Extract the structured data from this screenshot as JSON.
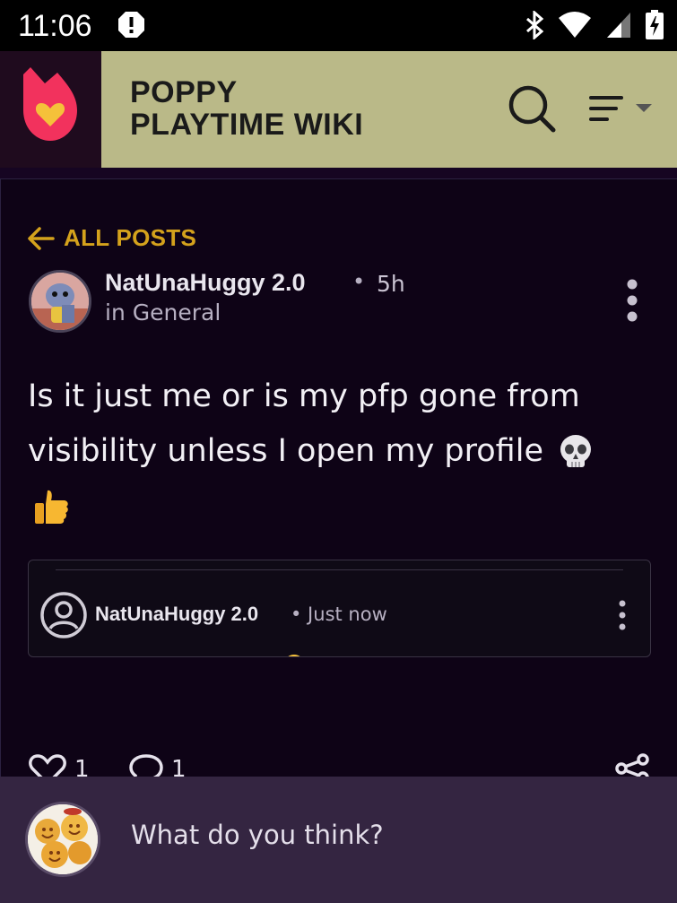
{
  "status_bar": {
    "time": "11:06"
  },
  "header": {
    "title_line1": "POPPY",
    "title_line2": "PLAYTIME WIKI"
  },
  "post": {
    "back_label": "ALL POSTS",
    "author": "NatUnaHuggy 2.0",
    "separator": "•",
    "time": "5h",
    "category": "in General",
    "body_text": "Is it just me or is my pfp gone from visibility unless I open my profile",
    "body_emojis": [
      "skull",
      "thumbs-up"
    ]
  },
  "reply": {
    "author": "NatUnaHuggy 2.0",
    "time": "• Just now"
  },
  "actions": {
    "likes": "1",
    "comments": "1"
  },
  "comment_bar": {
    "placeholder": "What do you think?"
  },
  "colors": {
    "accent": "#d4a21c",
    "title_bar": "#bab988",
    "background": "#0e0316",
    "comment_bar": "#342541",
    "brand": "#f2325d"
  }
}
